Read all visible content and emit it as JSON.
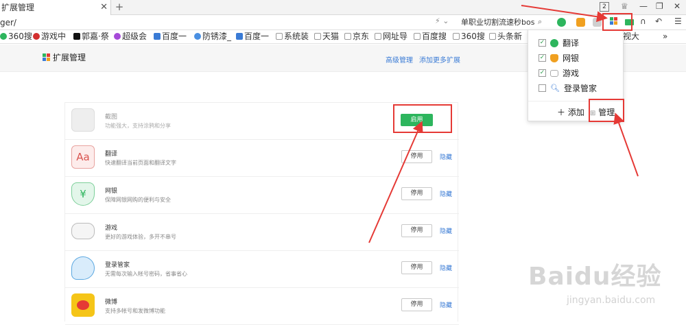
{
  "tab": {
    "title": "扩展管理",
    "close": "✕"
  },
  "window": {
    "new_tab": "+",
    "tab_count": "2",
    "shirt": "♕",
    "minimize": "—",
    "restore": "❐",
    "close": "✕"
  },
  "address": {
    "url": "ger/",
    "search_value": "单职业切割流速秒bos"
  },
  "bookmarks": [
    "360搜",
    "游戏中",
    "郭嘉·祭",
    "超级会",
    "百度一",
    "防锈漆_",
    "百度一",
    "系统装",
    "天猫",
    "京东",
    "网址导",
    "百度搜",
    "360搜",
    "头条新",
    "视大",
    "»"
  ],
  "page": {
    "title": "扩展管理",
    "advanced": "高级管理",
    "add_more": "添加更多扩展"
  },
  "extensions": [
    {
      "name": "截图",
      "desc": "功能强大，支持涂鸦和分享",
      "button": "启用",
      "hide": ""
    },
    {
      "name": "翻译",
      "desc": "快速翻译当前页面和翻译文字",
      "button": "停用",
      "hide": "隐藏",
      "icon_text": "Aa"
    },
    {
      "name": "网银",
      "desc": "保障网银网购的便利与安全",
      "button": "停用",
      "hide": "隐藏",
      "icon_text": "¥"
    },
    {
      "name": "游戏",
      "desc": "更好的游戏体验，多开不串号",
      "button": "停用",
      "hide": "隐藏"
    },
    {
      "name": "登录管家",
      "desc": "无需每次输入帐号密码，省事省心",
      "button": "停用",
      "hide": "隐藏"
    },
    {
      "name": "微博",
      "desc": "支持多帐号和发微博功能",
      "button": "停用",
      "hide": "隐藏"
    }
  ],
  "dropdown": {
    "items": [
      {
        "label": "翻译",
        "checked": "✓"
      },
      {
        "label": "网银",
        "checked": "✓"
      },
      {
        "label": "游戏",
        "checked": "✓"
      },
      {
        "label": "登录管家",
        "checked": ""
      }
    ],
    "add": "＋ 添加",
    "manage": "管理"
  },
  "watermark": {
    "main": "Baidu经验",
    "sub": "jingyan.baidu.com"
  },
  "colors": {
    "accent": "#2db55d",
    "link": "#3a7bd5",
    "highlight": "#e53935"
  }
}
